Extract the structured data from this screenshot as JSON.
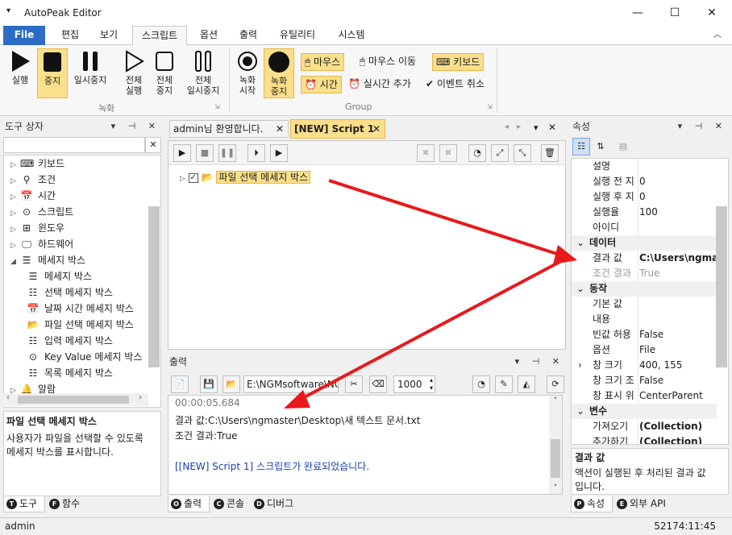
{
  "app": {
    "title": "AutoPeak Editor",
    "menu_glyph": "▾"
  },
  "window_controls": {
    "minimize": "—",
    "maximize": "☐",
    "close": "✕"
  },
  "ribbon_tabs": [
    "File",
    "편집",
    "보기",
    "스크립트",
    "옵션",
    "출력",
    "유틸리티",
    "시스템"
  ],
  "ribbon": {
    "record_group": {
      "label": "녹화",
      "buttons": [
        {
          "line1": "실행",
          "line2": ""
        },
        {
          "line1": "중지",
          "line2": ""
        },
        {
          "line1": "일시중지",
          "line2": ""
        },
        {
          "line1": "전체",
          "line2": "실행"
        },
        {
          "line1": "전체",
          "line2": "중지"
        },
        {
          "line1": "전체",
          "line2": "일시중지"
        }
      ]
    },
    "group_group": {
      "label": "Group",
      "rec_start": {
        "line1": "녹화",
        "line2": "시작"
      },
      "rec_stop": {
        "line1": "녹화",
        "line2": "중지"
      },
      "mouse": "마우스",
      "mouse_move": "마우스 이동",
      "keyboard": "키보드",
      "time": "시간",
      "realtime_add": "실시간 추가",
      "event_cancel": "이벤트 취소"
    }
  },
  "toolbox": {
    "title": "도구 상자",
    "search_clear": "✕",
    "items": [
      {
        "label": "키보드",
        "icon": "⌨",
        "expander": "▷",
        "indent": 0
      },
      {
        "label": "조건",
        "icon": "⚲",
        "expander": "▷",
        "indent": 0
      },
      {
        "label": "시간",
        "icon": "📅",
        "expander": "▷",
        "indent": 0
      },
      {
        "label": "스크립트",
        "icon": "⊙",
        "expander": "▷",
        "indent": 0
      },
      {
        "label": "윈도우",
        "icon": "⊞",
        "expander": "▷",
        "indent": 0
      },
      {
        "label": "하드웨어",
        "icon": "🖵",
        "expander": "▷",
        "indent": 0
      },
      {
        "label": "메세지 박스",
        "icon": "☰",
        "expander": "◢",
        "indent": 0
      },
      {
        "label": "메세지 박스",
        "icon": "☰",
        "expander": "",
        "indent": 1
      },
      {
        "label": "선택 메세지 박스",
        "icon": "☷",
        "expander": "",
        "indent": 1
      },
      {
        "label": "날짜 시간 메세지 박스",
        "icon": "📅",
        "expander": "",
        "indent": 1
      },
      {
        "label": "파일 선택 메세지 박스",
        "icon": "📂",
        "expander": "",
        "indent": 1
      },
      {
        "label": "입력 메세지 박스",
        "icon": "☷",
        "expander": "",
        "indent": 1
      },
      {
        "label": "Key Value 메세지 박스",
        "icon": "⊙",
        "expander": "",
        "indent": 1
      },
      {
        "label": "목록 메세지 박스",
        "icon": "☷",
        "expander": "",
        "indent": 1
      },
      {
        "label": "알람",
        "icon": "🔔",
        "expander": "▷",
        "indent": 0
      }
    ],
    "desc_title": "파일 선택 메세지 박스",
    "desc_text1": "사용자가 파일을 선택할 수 있도록",
    "desc_text2": "메세지 박스를 표시합니다.",
    "bottom_tabs": [
      {
        "letter": "T",
        "label": "도구"
      },
      {
        "letter": "F",
        "label": "함수"
      }
    ]
  },
  "doc_tabs": [
    {
      "label": "admin님 환영합니다.",
      "close": "✕"
    },
    {
      "label": "[NEW] Script 1",
      "close": "✕"
    }
  ],
  "script": {
    "node_label": "파일 선택 메세지 박스"
  },
  "output": {
    "title": "출력",
    "path": "E:\\NGMsoftware\\NG",
    "count": "1000",
    "lines": [
      "00:00:05.684",
      "결과 값:C:\\Users\\ngmaster\\Desktop\\새 텍스트 문서.txt",
      "조건 결과:True",
      "",
      "[[NEW] Script 1] 스크립트가 완료되었습니다."
    ],
    "bottom_tabs": [
      {
        "letter": "O",
        "label": "출력"
      },
      {
        "letter": "C",
        "label": "콘솔"
      },
      {
        "letter": "D",
        "label": "디버그"
      }
    ]
  },
  "properties": {
    "title": "속성",
    "rows": [
      {
        "type": "row",
        "key": "설명",
        "value": ""
      },
      {
        "type": "row",
        "key": "실행 전 지",
        "value": "0"
      },
      {
        "type": "row",
        "key": "실행 후 지",
        "value": "0"
      },
      {
        "type": "row",
        "key": "실행율",
        "value": "100"
      },
      {
        "type": "row",
        "key": "아이디",
        "value": ""
      },
      {
        "type": "cat",
        "key": "데이터"
      },
      {
        "type": "row",
        "key": "결과 값",
        "value": "C:\\Users\\ngma",
        "bold": true
      },
      {
        "type": "row",
        "key": "조건 결과",
        "value": "True",
        "gray": true
      },
      {
        "type": "cat",
        "key": "동작"
      },
      {
        "type": "row",
        "key": "기본 값",
        "value": ""
      },
      {
        "type": "row",
        "key": "내용",
        "value": ""
      },
      {
        "type": "row",
        "key": "빈값 허용",
        "value": "False"
      },
      {
        "type": "row",
        "key": "옵션",
        "value": "File"
      },
      {
        "type": "row",
        "key": "창 크기",
        "value": "400, 155",
        "expand": true
      },
      {
        "type": "row",
        "key": "창 크기 조",
        "value": "False"
      },
      {
        "type": "row",
        "key": "창 표시 위",
        "value": "CenterParent"
      },
      {
        "type": "cat",
        "key": "변수"
      },
      {
        "type": "row",
        "key": "가져오기",
        "value": "(Collection)",
        "bold": true
      },
      {
        "type": "row",
        "key": "추가하기",
        "value": "(Collection)",
        "bold": true
      }
    ],
    "desc_title": "결과 값",
    "desc_text1": "액션이 실행된 후 처리된 결과 값",
    "desc_text2": "입니다.",
    "bottom_tabs": [
      {
        "letter": "P",
        "label": "속성"
      },
      {
        "letter": "E",
        "label": "외부 API"
      }
    ]
  },
  "status": {
    "user": "admin",
    "time": "52174:11:45"
  },
  "colors": {
    "accent": "#2b6cc4",
    "highlight": "#fcdf8a",
    "arrow": "#e8191c"
  }
}
